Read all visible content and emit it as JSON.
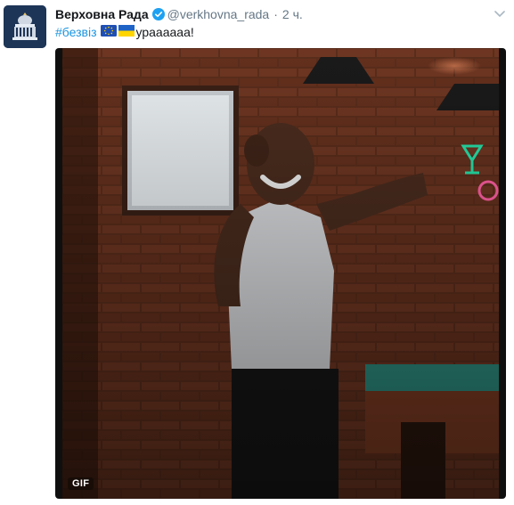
{
  "tweet": {
    "author_name": "Верховна Рада",
    "handle": "@verkhovna_rada",
    "separator": "·",
    "time": "2 ч.",
    "hashtag": "#безвіз",
    "text_after": "ураааааа!",
    "flags": [
      "eu-flag-icon",
      "ukraine-flag-icon"
    ]
  },
  "media": {
    "badge": "GIF"
  },
  "colors": {
    "link": "#1b95e0",
    "secondary": "#657786",
    "verified": "#1da1f2",
    "avatar_bg": "#1d3557"
  }
}
